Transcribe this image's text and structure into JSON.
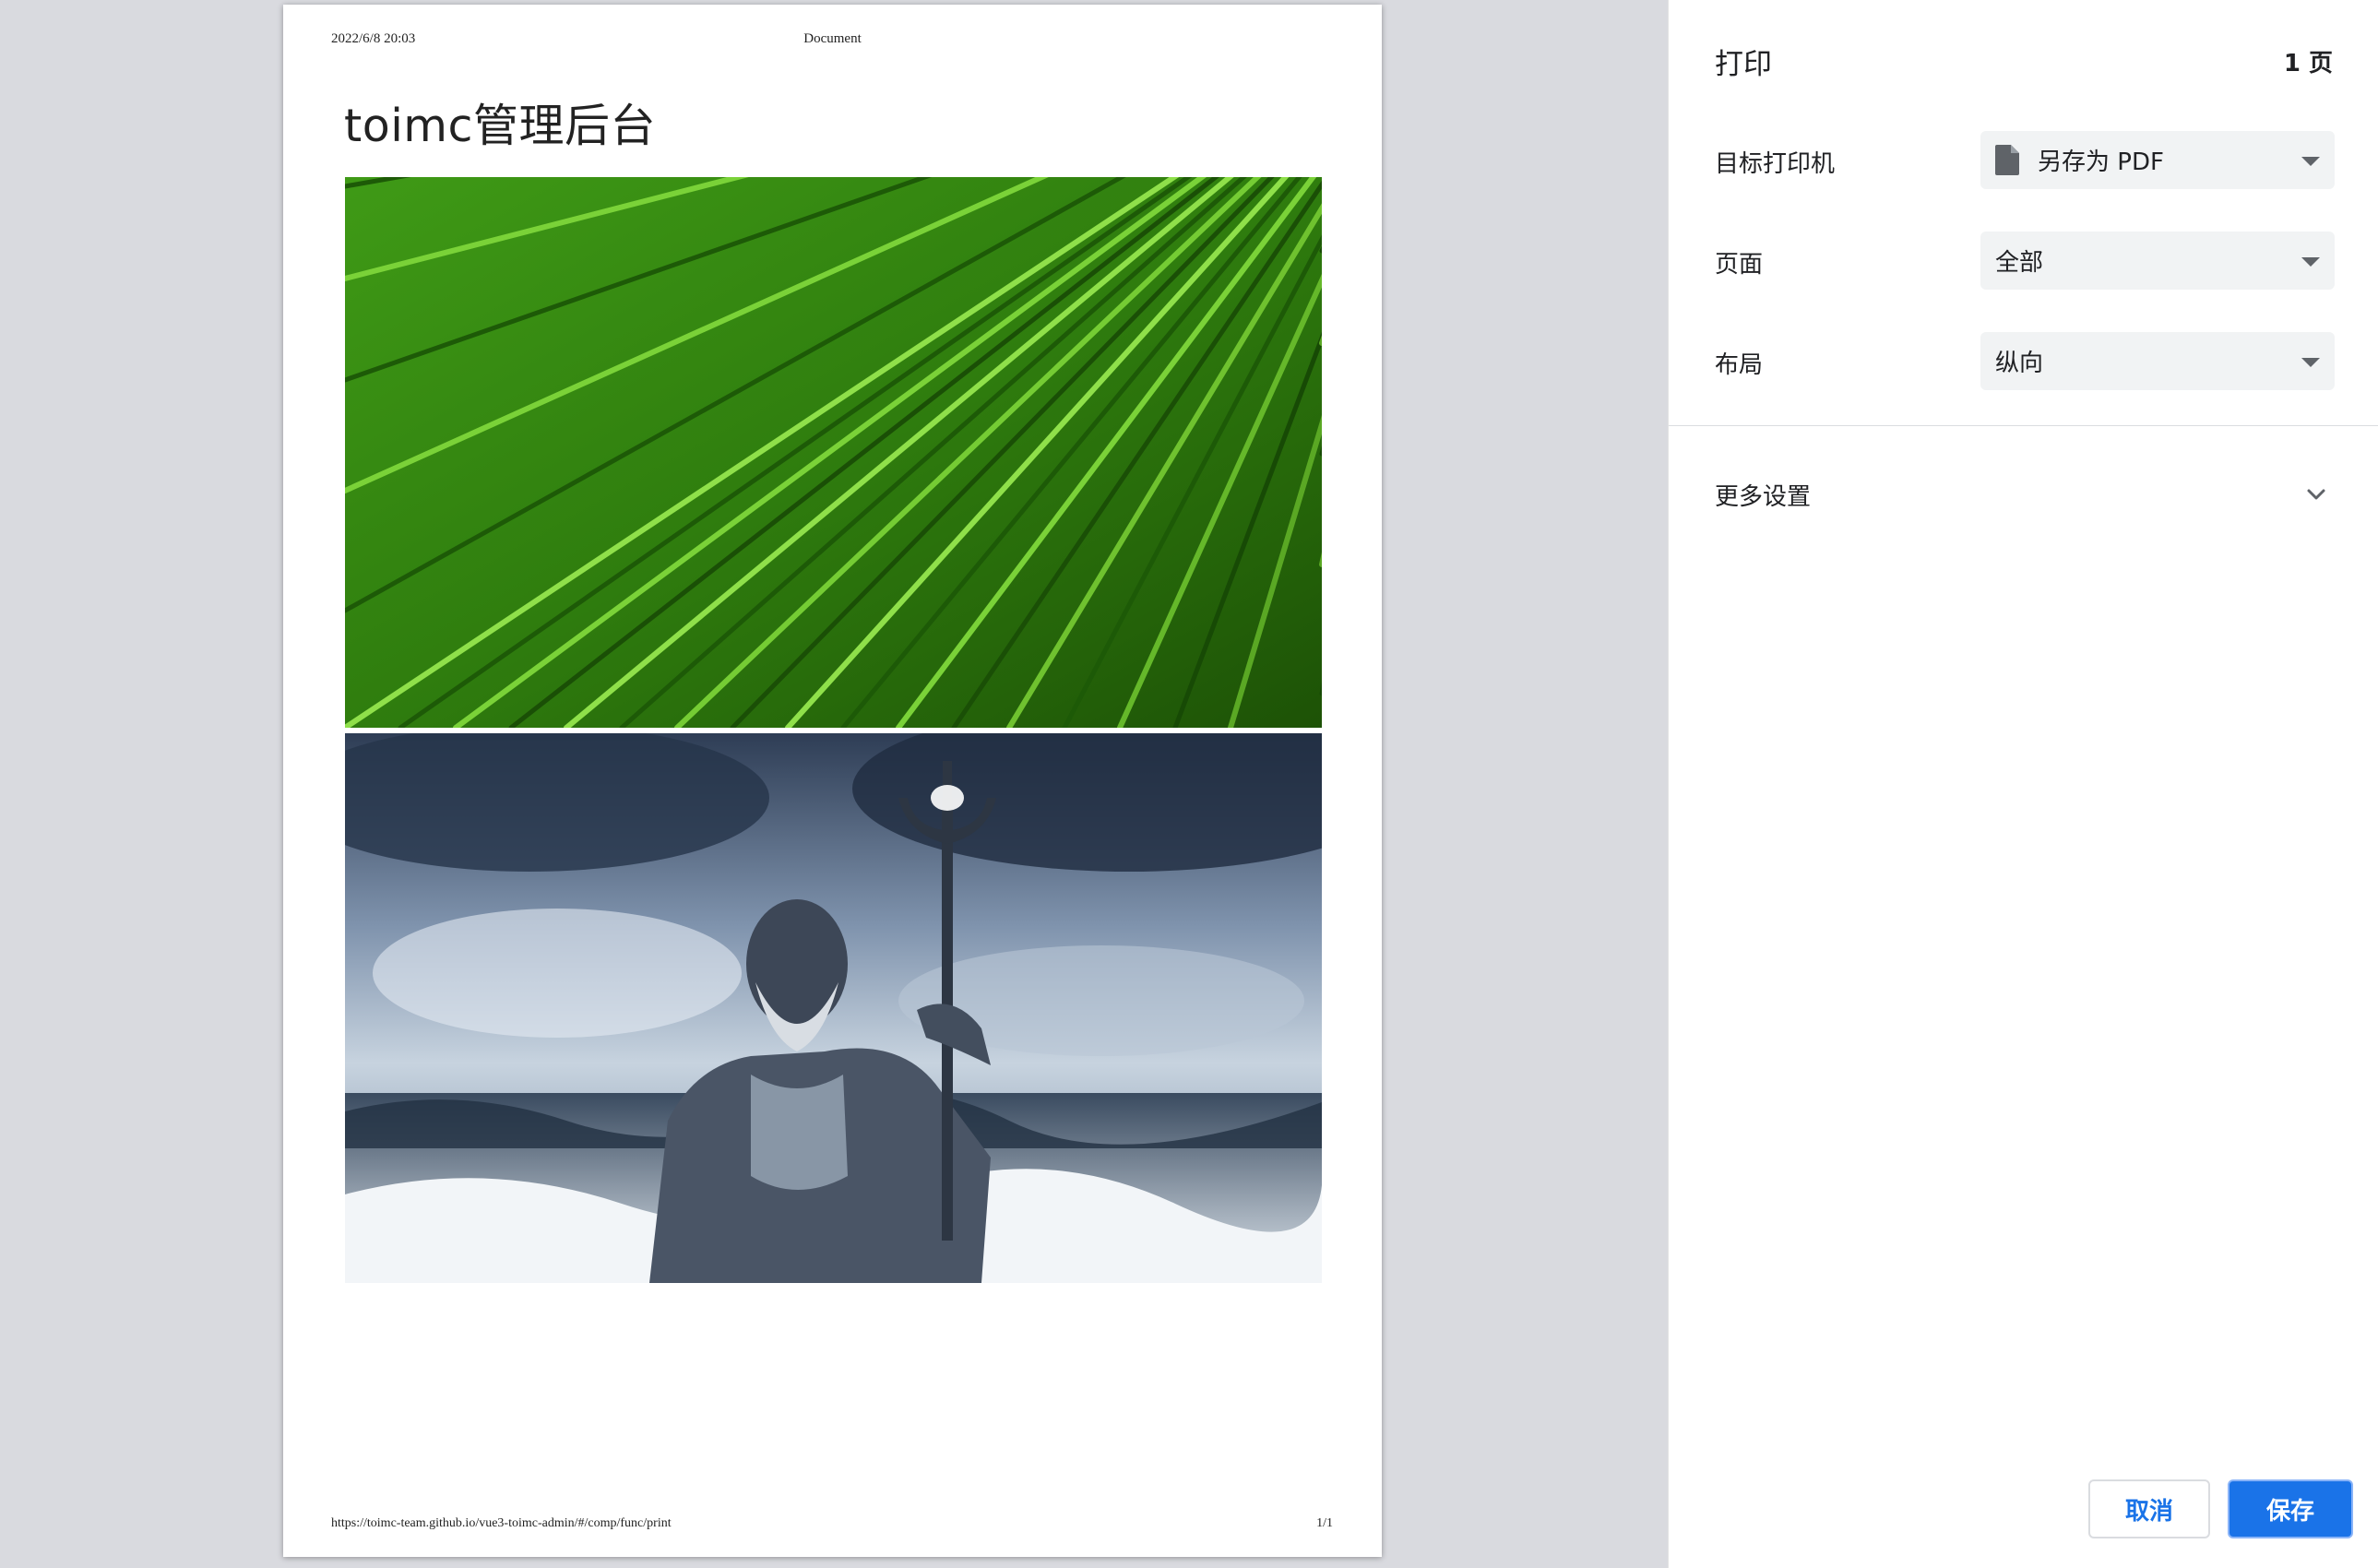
{
  "preview": {
    "header_date": "2022/6/8 20:03",
    "header_title": "Document",
    "page_title": "toimc管理后台",
    "footer_url": "https://toimc-team.github.io/vue3-toimc-admin/#/comp/func/print",
    "footer_page": "1/1"
  },
  "panel": {
    "title": "打印",
    "page_count": "1 页",
    "destination_label": "目标打印机",
    "destination_value": "另存为 PDF",
    "destination_icon": "file-icon",
    "pages_label": "页面",
    "pages_value": "全部",
    "layout_label": "布局",
    "layout_value": "纵向",
    "more_settings_label": "更多设置",
    "cancel_label": "取消",
    "save_label": "保存"
  },
  "colors": {
    "accent": "#1a73e8",
    "preview_bg": "#d9dadf",
    "select_bg": "#f1f3f4"
  }
}
